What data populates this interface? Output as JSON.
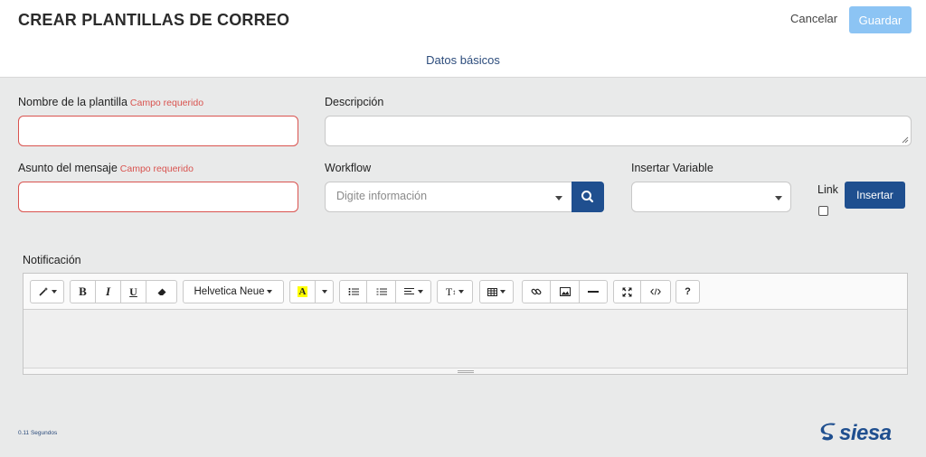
{
  "header": {
    "title": "CREAR PLANTILLAS DE CORREO",
    "cancel_label": "Cancelar",
    "save_label": "Guardar"
  },
  "tabs": {
    "basic_label": "Datos básicos"
  },
  "form": {
    "template_name": {
      "label": "Nombre de la plantilla",
      "required_text": "Campo requerido",
      "value": ""
    },
    "description": {
      "label": "Descripción",
      "value": ""
    },
    "subject": {
      "label": "Asunto del mensaje",
      "required_text": "Campo requerido",
      "value": ""
    },
    "workflow": {
      "label": "Workflow",
      "placeholder": "Digite información"
    },
    "insert_variable": {
      "label": "Insertar Variable",
      "value": ""
    },
    "link": {
      "label": "Link",
      "checked": false
    },
    "insert_button_label": "Insertar"
  },
  "editor": {
    "label": "Notificación",
    "font_name": "Helvetica Neue",
    "bold_label": "B",
    "italic_label": "I",
    "underline_label": "U",
    "color_label": "A",
    "height_label": "T",
    "help_label": "?",
    "highlight_color": "#ffff00"
  },
  "footer": {
    "time": "0.11 Segundos",
    "logo": "siesa"
  },
  "colors": {
    "primary": "#1f4f8f",
    "save_disabled": "#8cc4f4",
    "error": "#d9534f"
  }
}
